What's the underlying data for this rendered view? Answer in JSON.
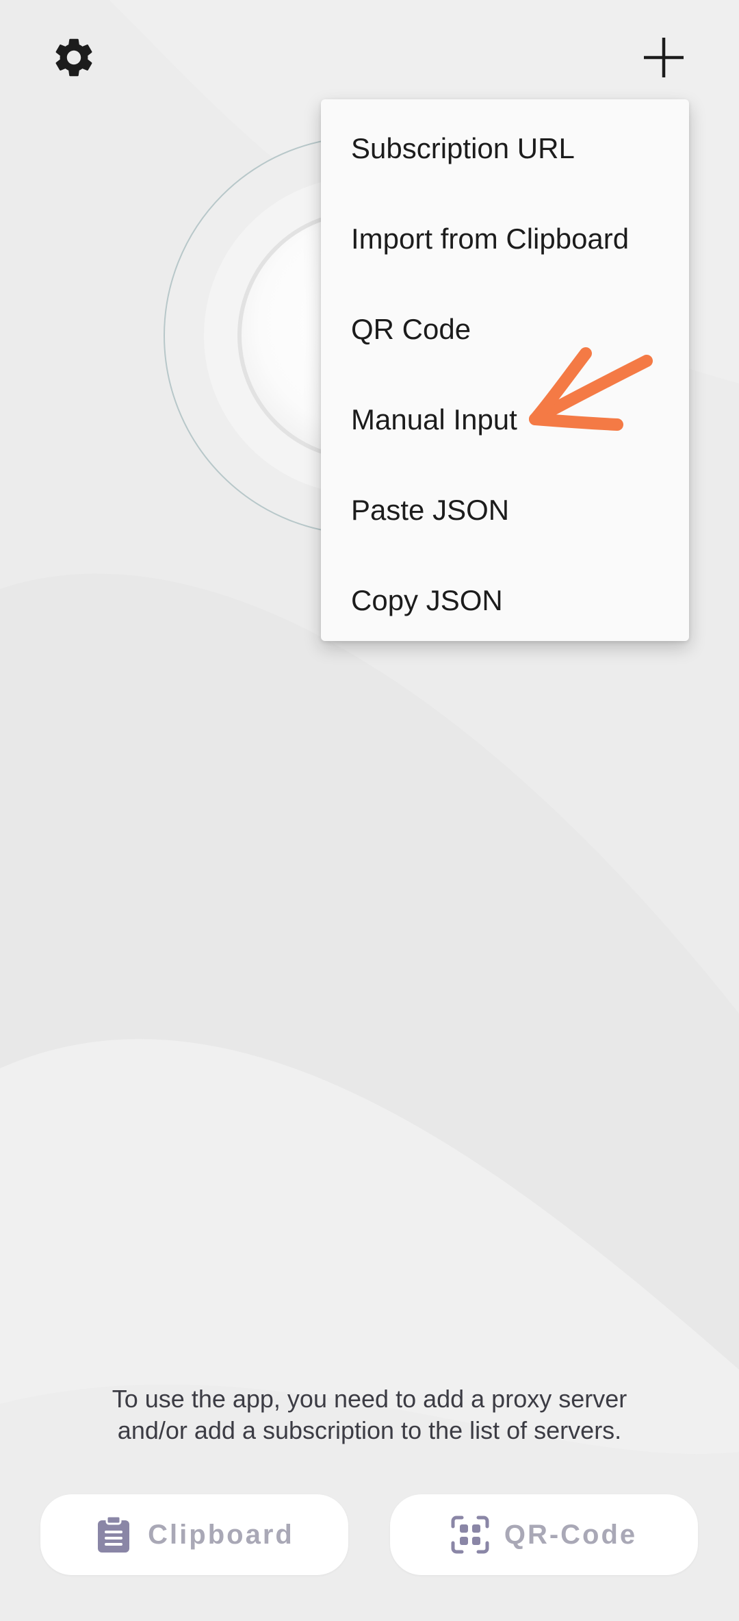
{
  "toolbar": {
    "settings_icon": "gear-icon",
    "add_icon": "plus-icon"
  },
  "menu": {
    "items": [
      {
        "label": "Subscription URL"
      },
      {
        "label": "Import from Clipboard"
      },
      {
        "label": "QR Code"
      },
      {
        "label": "Manual Input"
      },
      {
        "label": "Paste JSON"
      },
      {
        "label": "Copy JSON"
      }
    ]
  },
  "annotation": {
    "color": "#f47a45",
    "target": "Manual Input"
  },
  "hint": {
    "text": "To use the app, you need to add a proxy server and/or add a subscription to the list of servers."
  },
  "bottom_buttons": {
    "clipboard_label": "Clipboard",
    "clipboard_icon": "clipboard-icon",
    "qr_label": "QR-Code",
    "qr_icon": "qr-scan-icon"
  },
  "colors": {
    "background": "#ececec",
    "menu_bg": "#fafafa",
    "button_text": "#a9a8b6",
    "button_icon": "#8a86a6",
    "hint_text": "#3c3c44"
  }
}
